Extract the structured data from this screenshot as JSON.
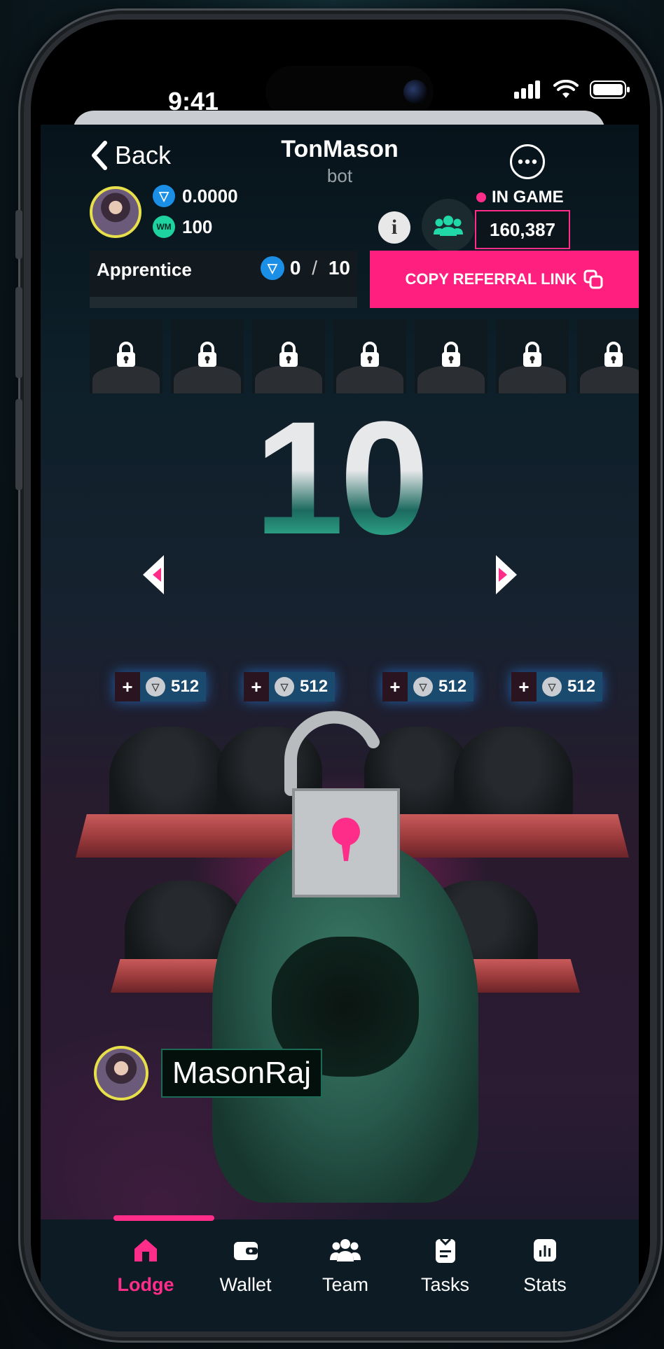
{
  "status_bar": {
    "time": "9:41"
  },
  "header": {
    "back_label": "Back",
    "title": "TonMason",
    "subtitle": "bot"
  },
  "balances": {
    "ton": "0.0000",
    "wm": "100",
    "wm_icon_text": "WM"
  },
  "ingame": {
    "label": "IN GAME",
    "count": "160,387"
  },
  "rank": {
    "name": "Apprentice",
    "current": "0",
    "separator": " / ",
    "target": "10",
    "progress_fraction": 0
  },
  "referral": {
    "label": "COPY REFERRAL LINK"
  },
  "level": {
    "number": "10"
  },
  "bonuses": [
    {
      "plus": "+",
      "value": "512"
    },
    {
      "plus": "+",
      "value": "512"
    },
    {
      "plus": "+",
      "value": "512"
    },
    {
      "plus": "+",
      "value": "512"
    }
  ],
  "user": {
    "name": "MasonRaj"
  },
  "tabs": [
    {
      "label": "Lodge",
      "icon": "home-icon",
      "active": true
    },
    {
      "label": "Wallet",
      "icon": "wallet-icon",
      "active": false
    },
    {
      "label": "Team",
      "icon": "team-icon",
      "active": false
    },
    {
      "label": "Tasks",
      "icon": "tasks-icon",
      "active": false
    },
    {
      "label": "Stats",
      "icon": "stats-icon",
      "active": false
    }
  ],
  "colors": {
    "accent": "#ff2d8a",
    "ton": "#1b8fe6",
    "wm": "#1ed3a0"
  }
}
